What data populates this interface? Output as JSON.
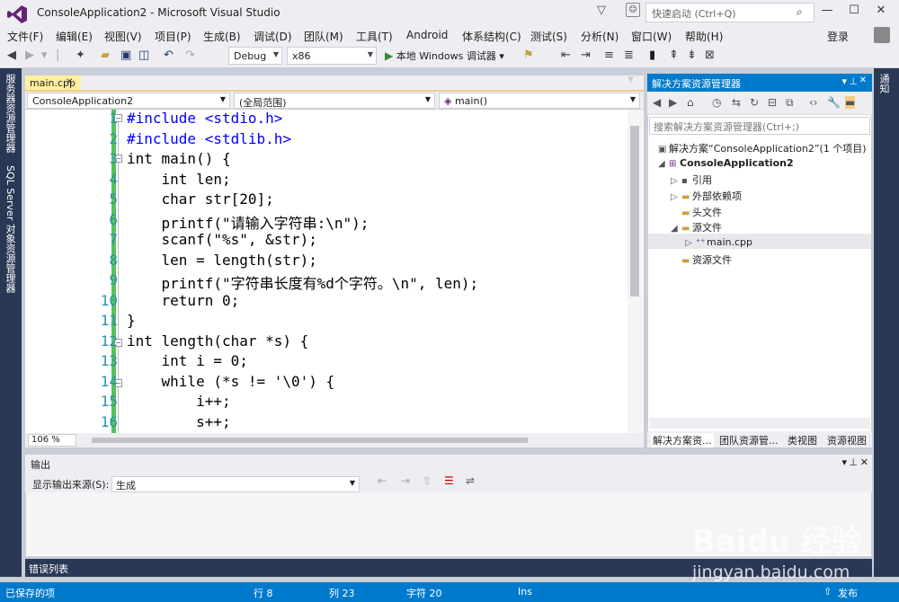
{
  "window": {
    "title": "ConsoleApplication2 - Microsoft Visual Studio",
    "quick_launch_placeholder": "快速启动 (Ctrl+Q)"
  },
  "menu": [
    "文件(F)",
    "编辑(E)",
    "视图(V)",
    "项目(P)",
    "生成(B)",
    "调试(D)",
    "团队(M)",
    "工具(T)",
    "Android",
    "体系结构(C)",
    "测试(S)",
    "分析(N)",
    "窗口(W)",
    "帮助(H)"
  ],
  "account": {
    "login": "登录"
  },
  "toolbar": {
    "config": "Debug",
    "platform": "x86",
    "run_label": "本地 Windows 调试器"
  },
  "left_tabs": [
    "服务器资源管理器",
    "SQL Server 对象资源管理器"
  ],
  "right_edge_tab": "通知",
  "editor": {
    "tab": "main.cpp",
    "nav": {
      "project": "ConsoleApplication2",
      "scope": "(全局范围)",
      "member": "main()"
    },
    "zoom": "106 %",
    "lines": [
      {
        "n": "1",
        "text": "#include <stdio.h>"
      },
      {
        "n": "2",
        "text": "#include <stdlib.h>"
      },
      {
        "n": "3",
        "text": "int main() {"
      },
      {
        "n": "4",
        "text": "    int len;"
      },
      {
        "n": "5",
        "text": "    char str[20];"
      },
      {
        "n": "6",
        "text": "    printf(\"请输入字符串:\\n\");"
      },
      {
        "n": "7",
        "text": "    scanf(\"%s\", &str);"
      },
      {
        "n": "8",
        "text": "    len = length(str);"
      },
      {
        "n": "9",
        "text": "    printf(\"字符串长度有%d个字符。\\n\", len);"
      },
      {
        "n": "10",
        "text": "    return 0;"
      },
      {
        "n": "11",
        "text": "}"
      },
      {
        "n": "12",
        "text": "int length(char *s) {"
      },
      {
        "n": "13",
        "text": "    int i = 0;"
      },
      {
        "n": "14",
        "text": "    while (*s != '\\0') {"
      },
      {
        "n": "15",
        "text": "        i++;"
      },
      {
        "n": "16",
        "text": "        s++;"
      }
    ]
  },
  "solution_explorer": {
    "title": "解决方案资源管理器",
    "search_placeholder": "搜索解决方案资源管理器(Ctrl+;)",
    "tree": [
      {
        "label": "解决方案“ConsoleApplication2”(1 个项目)"
      },
      {
        "label": "ConsoleApplication2"
      },
      {
        "label": "引用"
      },
      {
        "label": "外部依赖项"
      },
      {
        "label": "头文件"
      },
      {
        "label": "源文件"
      },
      {
        "label": "main.cpp"
      },
      {
        "label": "资源文件"
      }
    ],
    "tabs": [
      "解决方案资...",
      "团队资源管...",
      "类视图",
      "资源视图"
    ]
  },
  "output": {
    "title": "输出",
    "source_label": "显示输出来源(S):",
    "source_value": "生成"
  },
  "error_tab": "错误列表",
  "status": {
    "saved": "已保存的项",
    "row": "行 8",
    "col": "列 23",
    "char": "字符 20",
    "mode": "Ins",
    "publish": "发布"
  },
  "watermark": {
    "line1": "Baidu 经验",
    "line2": "jingyan.baidu.com"
  },
  "colors": {
    "accent": "#007acc",
    "vs_purple": "#68217a",
    "green_margin": "#56c25a",
    "keyword": "#0000ff",
    "string": "#a31515",
    "line_number": "#2b91af"
  }
}
